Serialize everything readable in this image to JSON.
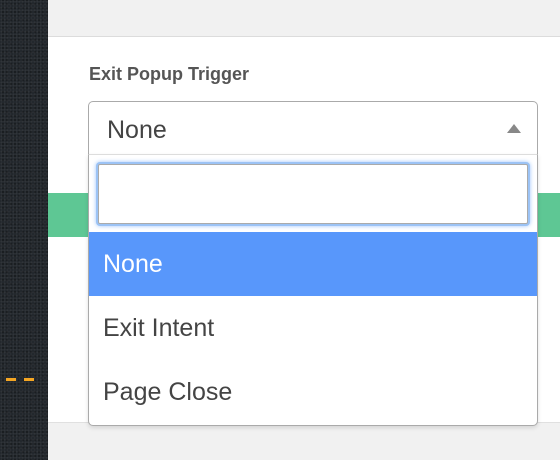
{
  "field": {
    "label": "Exit Popup Trigger"
  },
  "select": {
    "selected_value": "None",
    "search_placeholder": "",
    "options": [
      {
        "label": "None",
        "highlighted": true
      },
      {
        "label": "Exit Intent",
        "highlighted": false
      },
      {
        "label": "Page Close",
        "highlighted": false
      }
    ]
  },
  "colors": {
    "highlight": "#5897fb",
    "green_band": "#5ec794",
    "sidebar": "#23282d",
    "marker": "#f5a623"
  },
  "icons": {
    "select_arrow": "triangle-up-icon"
  }
}
